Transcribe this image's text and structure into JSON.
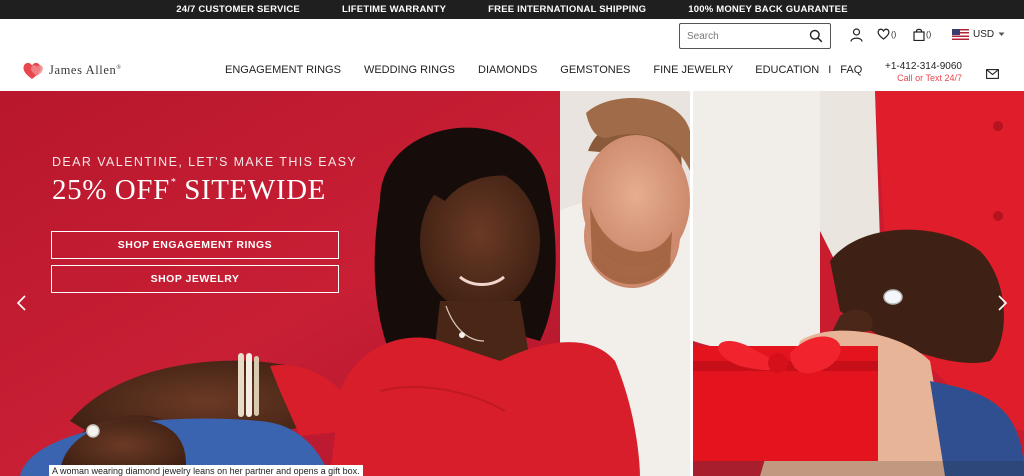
{
  "promo_bar": [
    "24/7 CUSTOMER SERVICE",
    "LIFETIME WARRANTY",
    "FREE INTERNATIONAL SHIPPING",
    "100% MONEY BACK GUARANTEE"
  ],
  "search": {
    "placeholder": "Search",
    "value": ""
  },
  "utility": {
    "wishlist_count": "()",
    "cart_count": "()",
    "currency": "USD"
  },
  "brand": {
    "name": "James Allen",
    "mark": "®"
  },
  "nav": {
    "links": [
      "ENGAGEMENT RINGS",
      "WEDDING RINGS",
      "DIAMONDS",
      "GEMSTONES",
      "FINE JEWELRY",
      "EDUCATION"
    ],
    "separator": "I",
    "faq": "FAQ"
  },
  "contact": {
    "phone": "+1-412-314-9060",
    "subtext": "Call or Text 24/7"
  },
  "hero": {
    "eyebrow": "DEAR VALENTINE, LET'S MAKE THIS EASY",
    "headline": "25% OFF",
    "headline_mark": "*",
    "headline_suffix": "SITEWIDE",
    "cta_primary": "SHOP ENGAGEMENT RINGS",
    "cta_secondary": "SHOP JEWELRY",
    "caption": "A woman wearing diamond jewelry leans on her partner and opens a gift box."
  },
  "colors": {
    "hero_red": "#c41830",
    "accent": "#e8474d",
    "promo_bg": "#1f1f1f"
  }
}
